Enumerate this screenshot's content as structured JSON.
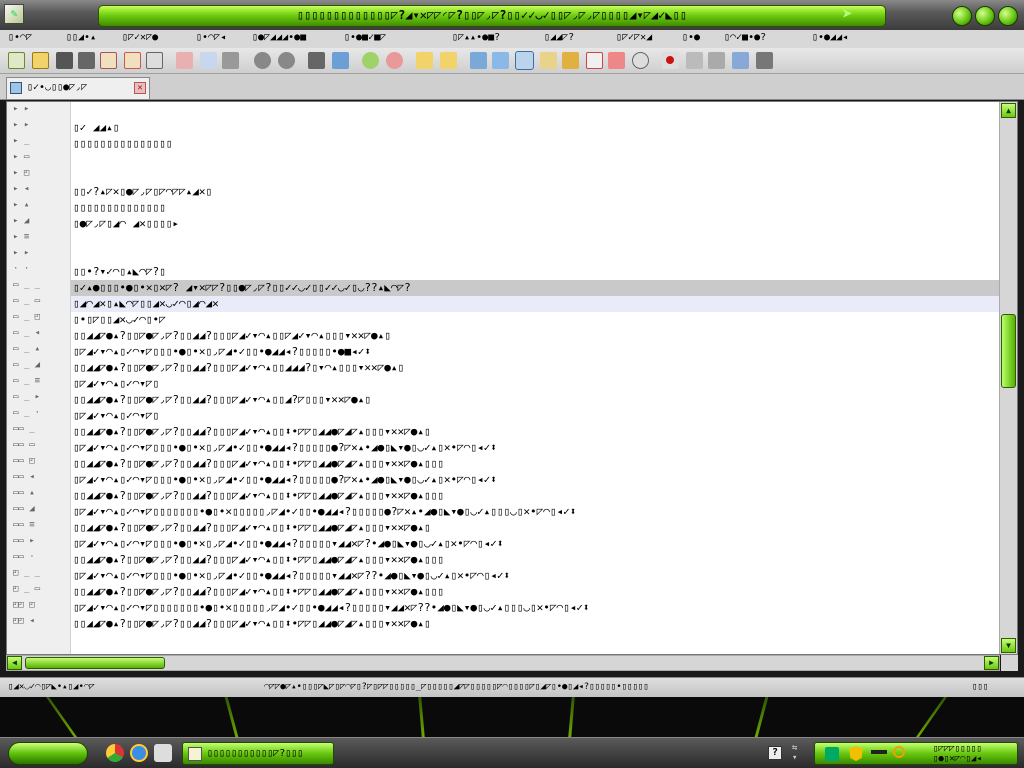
{
  "window": {
    "title": "▯▯▯▯▯▯▯▯▯▯▯▯▯◸?◢▾✕◸◸◜◸?▯▯◸◞◸?▯▯✓✓◡✓▯▯◸◞◸◞◸▯▯▯▯◢▾◸◢✓◣▯▯",
    "buttons": [
      "minimize",
      "maximize",
      "close"
    ]
  },
  "menu": [
    {
      "label": "▯•◠◸"
    },
    {
      "label": "▯▯◢•▴"
    },
    {
      "label": "▯◸✓✕◸●"
    },
    {
      "label": "▯•◠◸◂"
    },
    {
      "label": "▯●◸◢◢◢•●■"
    },
    {
      "label": "▯•●■✓■◸"
    },
    {
      "label": "▯◸▴▴•●■?"
    },
    {
      "label": "▯◢◢◸?"
    },
    {
      "label": "▯◸✓◸✕◢"
    },
    {
      "label": "▯•●"
    },
    {
      "label": "▯◠✓■•●?"
    },
    {
      "label": "▯•●◢◢◂"
    }
  ],
  "toolbar": {
    "icons": [
      "new-file",
      "open-folder",
      "save",
      "save-all",
      "close-file",
      "print-preview",
      "print",
      "cut",
      "copy",
      "paste",
      "undo",
      "redo",
      "find",
      "replace",
      "zoom-in",
      "zoom-out",
      "sync-v",
      "sync-h",
      "word-wrap",
      "show-all",
      "indent-guide",
      "doc-map",
      "function-list",
      "folder-view",
      "monitoring",
      "record",
      "stop",
      "play",
      "run-multiple",
      "save-macro"
    ]
  },
  "tabs": [
    {
      "label": "▯✓•◡▯▯●◸◞◸",
      "close": "✕"
    }
  ],
  "gutter": [
    "▸ ▸",
    "▸ ▸",
    "▸ _",
    "▸ ▭",
    "▸ ◰",
    "▸ ◂",
    "▸ ▴",
    "▸ ◢",
    "▸ ≡",
    "▸ ▸",
    "· ·",
    "▭ _ _",
    "▭ _ ▭",
    "▭ _ ◰",
    "▭ _ ◂",
    "▭ _ ▴",
    "▭ _ ◢",
    "▭ _ ≡",
    "▭ _ ▸",
    "▭ _ ·",
    "▭▭ _",
    "▭▭ ▭",
    "▭▭ ◰",
    "▭▭ ◂",
    "▭▭ ▴",
    "▭▭ ◢",
    "▭▭ ≡",
    "▭▭ ▸",
    "▭▭ ·",
    "◰ _ _",
    "◰ _ ▭",
    "◰◰ ◰",
    "◰◰ ◂"
  ],
  "lines": [
    "",
    "▯✓ ◢◢▴▯",
    "▯▯▯▯▯▯▯▯▯▯▯▯▯▯▯",
    "",
    "",
    "▯▯✓?▴◸✕▯●◸◞◸▯◸◠◸◸▴◢✕▯",
    "▯▯▯▯▯▯▯▯▯▯▯▯▯▯",
    "▯●◸◞◸▯◢◠ ◢✕▯▯▯▯▸",
    "",
    "",
    "▯▯•?▾✓◠▯▴◣◠◸?▯",
    "▯✓▴●▯▯▯•●▯•✕▯✕◸? ◢▾✕◸◸?▯▯●◸◞◸?▯▯✓✓◡✓▯▯✓✓◡✓▯◡??▴◣◠◸?",
    "▯◢◠◢✕▯▴◣◠◸▯▯◢✕◡✓◠▯◢◠◢✕",
    "▯•▯◸▯▯◢✕◡✓◠▯•◸",
    "▯▯◢◢◸●▴?▯▯◸●◸◞◸?▯▯◢◢?▯▯▯◸◢✓▾◠▴▯▯◸◢✓▾◠▴▯▯▯▾✕✕◸●▴▯",
    "▯◸◢✓▾◠▴▯✓◠▾◸▯▯▯•●▯•✕▯◞◸◢•✓▯▯•●◢◢◂?▯▯▯▯▯•●■◂✓⬍",
    "▯▯◢◢◸●▴?▯▯◸●◸◞◸?▯▯◢◢?▯▯▯◸◢✓▾◠▴▯▯◢◢◢?▯▾◠▴▯▯▯▾✕✕◸●▴▯",
    "▯◸◢✓▾◠▴▯✓◠▾◸▯",
    "▯▯◢◢◸●▴?▯▯◸●◸◞◸?▯▯◢◢?▯▯▯◸◢✓▾◠▴▯▯◢?◸▯▯▯▾✕✕◸●▴▯",
    "▯◸◢✓▾◠▴▯✓◠▾◸▯",
    "▯▯◢◢◸●▴?▯▯◸●◸◞◸?▯▯◢◢?▯▯▯◸◢✓▾◠▴▯▯⬍•◸◸▯◢◢●◸◢◸▴▯▯▯▾✕✕◸●▴▯",
    "▯◸◢✓▾◠▴▯✓◠▾◸▯▯▯•●▯•✕▯◞◸◢•✓▯▯•●◢◢◂?▯▯▯▯▯●?◸✕▴•◢●▯◣▾●▯◡✓▴▯✕•◸◠▯◂✓⬍",
    "▯▯◢◢◸●▴?▯▯◸●◸◞◸?▯▯◢◢?▯▯▯◸◢✓▾◠▴▯▯⬍•◸◸▯◢◢●◸◢◸▴▯▯▯▾✕✕◸●▴▯▯▯",
    "▯◸◢✓▾◠▴▯✓◠▾◸▯▯▯•●▯•✕▯◞◸◢•✓▯▯•●◢◢◂?▯▯▯▯▯●?◸✕▴•◢●▯◣▾●▯◡✓▴▯✕•◸◠▯◂✓⬍",
    "▯▯◢◢◸●▴?▯▯◸●◸◞◸?▯▯◢◢?▯▯▯◸◢✓▾◠▴▯▯⬍•◸◸▯◢◢●◸◢◸▴▯▯▯▾✕✕◸●▴▯▯▯",
    "▯◸◢✓▾◠▴▯✓◠▾◸▯▯▯▯▯▯▯•●▯•✕▯▯▯▯▯◞◸◢•✓▯▯•●◢◢◂?▯▯▯▯▯●?◸✕▴•◢●▯◣▾●▯◡✓▴▯▯▯◡▯✕•◸◠▯◂✓⬍",
    "▯▯◢◢◸●▴?▯▯◸●◸◞◸?▯▯◢◢?▯▯▯◸◢✓▾◠▴▯▯⬍•◸◸▯◢◢●◸◢◸▴▯▯▯▾✕✕◸●▴▯",
    "▯◸◢✓▾◠▴▯✓◠▾◸▯▯▯•●▯•✕▯◞◸◢•✓▯▯•●◢◢◂?▯▯▯▯▯▾◢◢✕◸?•◢●▯◣▾●▯◡✓▴▯✕•◸◠▯◂✓⬍",
    "▯▯◢◢◸●▴?▯▯◸●◸◞◸?▯▯◢◢?▯▯▯◸◢✓▾◠▴▯▯⬍•◸◸▯◢◢●◸◢◸▴▯▯▯▾✕✕◸●▴▯▯▯",
    "▯◸◢✓▾◠▴▯✓◠▾◸▯▯▯•●▯•✕▯◞◸◢•✓▯▯•●◢◢◂?▯▯▯▯▯▾◢◢✕◸??•◢●▯◣▾●▯◡✓▴▯✕•◸◠▯◂✓⬍",
    "▯▯◢◢◸●▴?▯▯◸●◸◞◸?▯▯◢◢?▯▯▯◸◢✓▾◠▴▯▯⬍•◸◸▯◢◢●◸◢◸▴▯▯▯▾✕✕◸●▴▯▯▯",
    "▯◸◢✓▾◠▴▯✓◠▾◸▯▯▯▯▯▯▯•●▯•✕▯▯▯▯▯◞◸◢•✓▯▯•●◢◢◂?▯▯▯▯▯▾◢◢✕◸??•◢●▯◣▾●▯◡✓▴▯▯▯◡▯✕•◸◠▯◂✓⬍",
    "▯▯◢◢◸●▴?▯▯◸●◸◞◸?▯▯◢◢?▯▯▯◸◢✓▾◠▴▯▯⬍•◸◸▯◢◢●◸◢◸▴▯▯▯▾✕✕◸●▴▯"
  ],
  "statusbar": {
    "left": "▯◢✕◡✓◠▯◸◣•▴▯◢•◠◸",
    "middle": "◠◸◸●◸▴•▯▯▯◸◣◸▯◸◠◸▯?◸▯◸◸▯▯▯▯▯_◸▯▯▯▯▯◢◸◸▯▯▯▯▯◸◠▯▯▯▯◸▯◢◸▯•●▯◢◂?▯▯▯▯▯•▯▯▯▯▯",
    "right": "▯▯▯"
  },
  "taskbar": {
    "task_label": "▯▯▯▯▯▯▯▯▯▯▯◸?▯▯▯",
    "help": "?",
    "clock_top": "▯◸◸◸▯▯▯▯▯",
    "clock_bottom": "▯●▯✕◸◠▯◢◂"
  },
  "colors": {
    "accent": "#6bc911",
    "chrome": "#4a4a4a",
    "editor_bg": "#ffffff",
    "highlight_gray": "#c9c9c9",
    "highlight_blue": "#e9ecf8"
  }
}
